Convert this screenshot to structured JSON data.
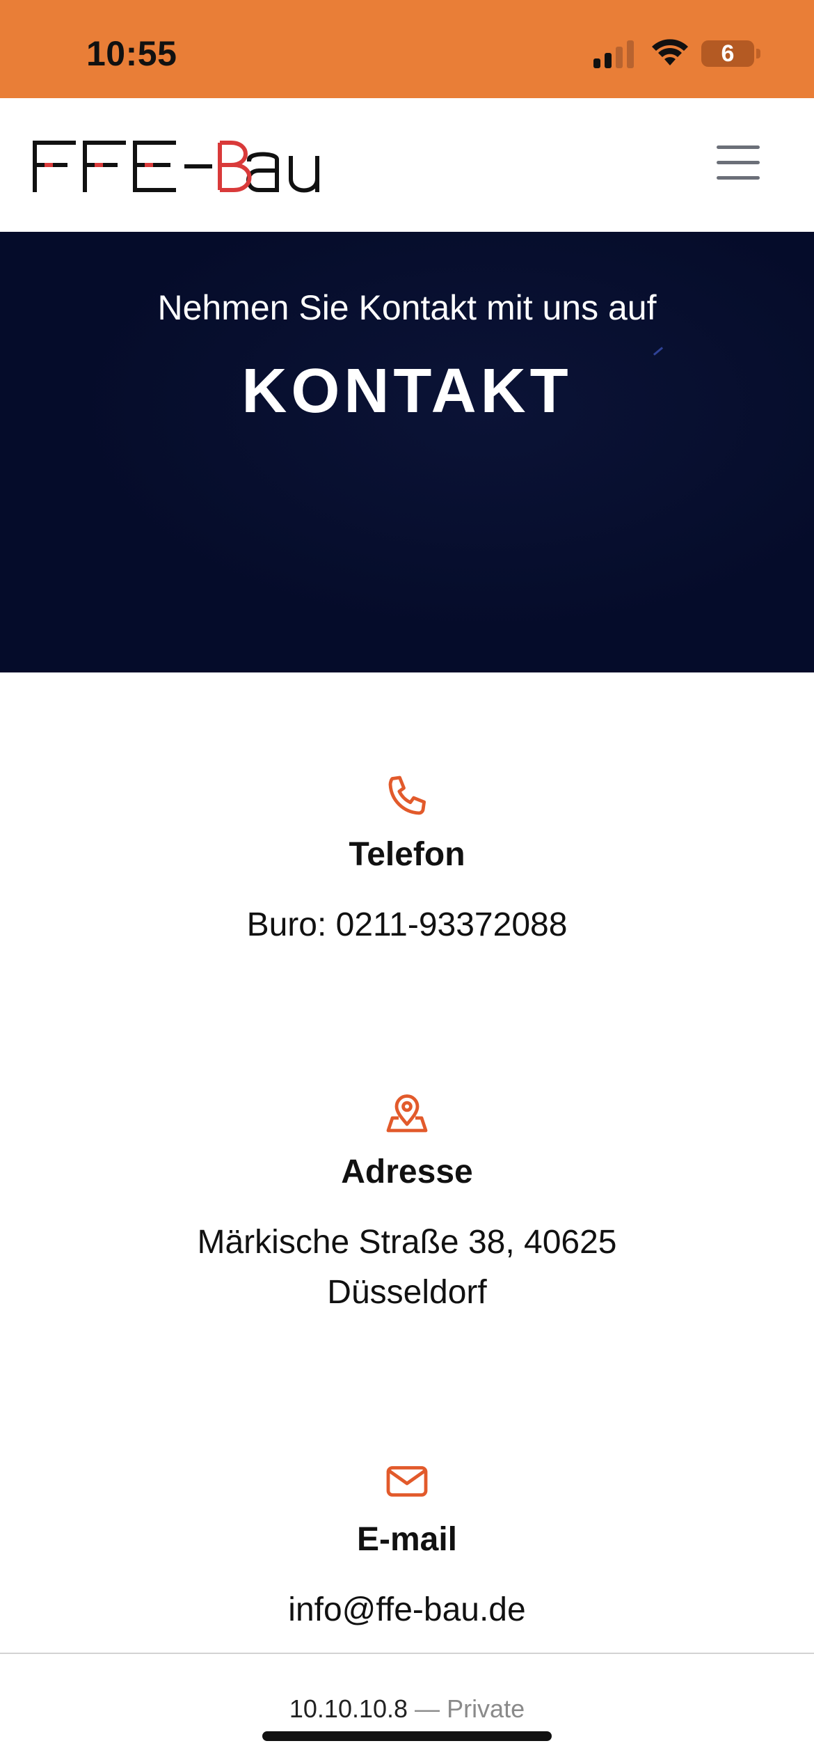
{
  "status_bar": {
    "time": "10:55",
    "battery_level": "6",
    "background_color": "#E97E37"
  },
  "header": {
    "logo_text_black": "FFE-",
    "logo_text_red": "Bau",
    "logo_colors": {
      "black": "#111111",
      "red": "#D93A3A"
    },
    "menu_icon": "hamburger-icon"
  },
  "hero": {
    "subtitle": "Nehmen Sie Kontakt mit uns auf",
    "title": "KONTAKT",
    "background_color": "#050C2A"
  },
  "contact": {
    "accent_color": "#E25A2B",
    "phone": {
      "icon": "phone-icon",
      "heading": "Telefon",
      "value": "Buro: 0211-93372088"
    },
    "address": {
      "icon": "map-pin-icon",
      "heading": "Adresse",
      "value": "Märkische Straße 38, 40625 Düsseldorf"
    },
    "email": {
      "icon": "mail-icon",
      "heading": "E-mail",
      "value": "info@ffe-bau.de"
    }
  },
  "browser_bar": {
    "ip": "10.10.10.8",
    "separator": "—",
    "label": "Private"
  }
}
